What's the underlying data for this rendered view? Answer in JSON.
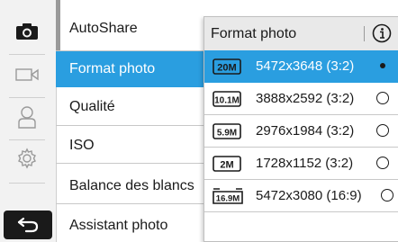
{
  "rail": {
    "tabs": [
      {
        "icon": "camera-icon",
        "active": true
      },
      {
        "icon": "video-icon",
        "active": false
      },
      {
        "icon": "user-icon",
        "active": false
      },
      {
        "icon": "settings-icon",
        "active": false
      }
    ],
    "back_icon": "back-arrow-icon"
  },
  "menu": {
    "items": [
      {
        "label": "AutoShare"
      },
      {
        "label": "Format photo",
        "selected": true
      },
      {
        "label": "Qualité"
      },
      {
        "label": "ISO"
      },
      {
        "label": "Balance des blancs"
      },
      {
        "label": "Assistant photo"
      }
    ]
  },
  "popup": {
    "title": "Format photo",
    "info_icon": "info-icon",
    "options": [
      {
        "badge": "20M",
        "resolution": "5472x3648 (3:2)",
        "selected": true
      },
      {
        "badge": "10.1M",
        "resolution": "3888x2592 (3:2)",
        "selected": false
      },
      {
        "badge": "5.9M",
        "resolution": "2976x1984 (3:2)",
        "selected": false
      },
      {
        "badge": "2M",
        "resolution": "1728x1152 (3:2)",
        "selected": false
      },
      {
        "badge": "16.9M",
        "resolution": "5472x3080 (16:9)",
        "selected": false
      }
    ]
  },
  "colors": {
    "accent": "#2a9ee0",
    "rail_bg": "#f2f2f2",
    "back_bg": "#1a1a1a"
  }
}
